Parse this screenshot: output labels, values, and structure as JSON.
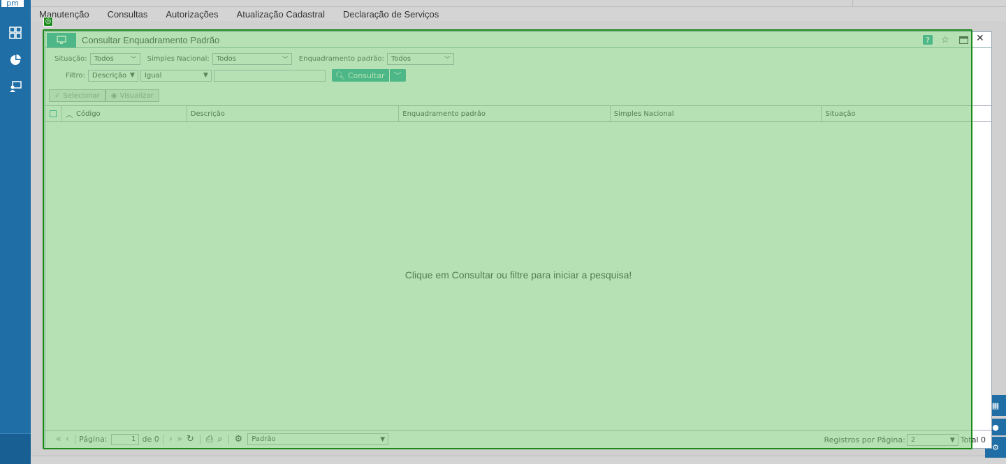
{
  "app": {
    "logo_text": "pm",
    "menu": [
      "Manutenção",
      "Consultas",
      "Autorizações",
      "Atualização Cadastral",
      "Declaração de Serviços"
    ]
  },
  "window": {
    "title": "Consultar Enquadramento Padrão",
    "help_label": "?",
    "star_icon": "star-icon",
    "maximize_icon": "maximize-icon",
    "close_label": "✕"
  },
  "filters": {
    "situacao_label": "Situação:",
    "situacao_value": "Todos",
    "simples_label": "Simples Nacional:",
    "simples_value": "Todos",
    "enquadramento_label": "Enquadramento padrão:",
    "enquadramento_value": "Todos",
    "filtro_label": "Filtro:",
    "filtro_field": "Descrição",
    "filtro_operator": "Igual",
    "filtro_text": "",
    "consultar_label": "Consultar"
  },
  "actions": {
    "selecionar_label": "Selecionar",
    "visualizar_label": "Visualizar"
  },
  "grid": {
    "columns": [
      "Código",
      "Descrição",
      "Enquadramento padrão",
      "Simples Nacional",
      "Situação"
    ],
    "empty_message": "Clique em Consultar ou filtre para iniciar a pesquisa!"
  },
  "footer": {
    "page_label": "Página:",
    "page_value": "1",
    "of_label": "de 0",
    "layout_value": "Padrão",
    "per_page_label": "Registros por Página:",
    "per_page_value": "2",
    "total_label": "Total 0"
  },
  "colors": {
    "accent": "#1aa39a",
    "rail": "#1f6ea5",
    "overlay": "#78c878",
    "overlay_border": "#1b8a1b"
  }
}
